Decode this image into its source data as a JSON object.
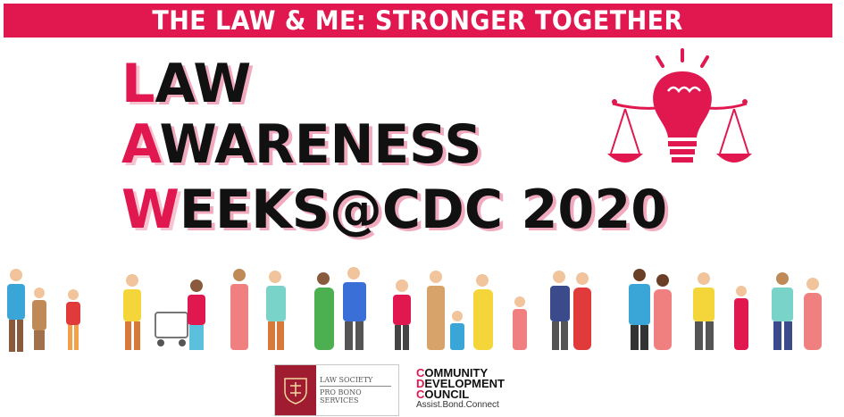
{
  "banner": {
    "text": "THE LAW & ME: STRONGER TOGETHER"
  },
  "title": {
    "line1": {
      "initial": "L",
      "rest": "AW"
    },
    "line2": {
      "initial": "A",
      "rest": "WARENESS"
    },
    "line3": {
      "initial": "W",
      "rest": "EEKS@CDC 2020"
    }
  },
  "logos": {
    "law_society": {
      "line1": "LAW SOCIETY",
      "line2": "PRO BONO SERVICES"
    },
    "cdc": {
      "lines": [
        {
          "initial": "C",
          "rest": "OMMUNITY"
        },
        {
          "initial": "D",
          "rest": "EVELOPMENT"
        },
        {
          "initial": "C",
          "rest": "OUNCIL"
        }
      ],
      "tagline": "Assist.Bond.Connect"
    }
  },
  "colors": {
    "accent": "#e0184f",
    "accent_light": "#f1a9bd",
    "crest": "#a01c31",
    "text": "#111111"
  },
  "icons": [
    "lightbulb-scales-icon",
    "crowd-illustration",
    "law-society-crest-icon"
  ]
}
